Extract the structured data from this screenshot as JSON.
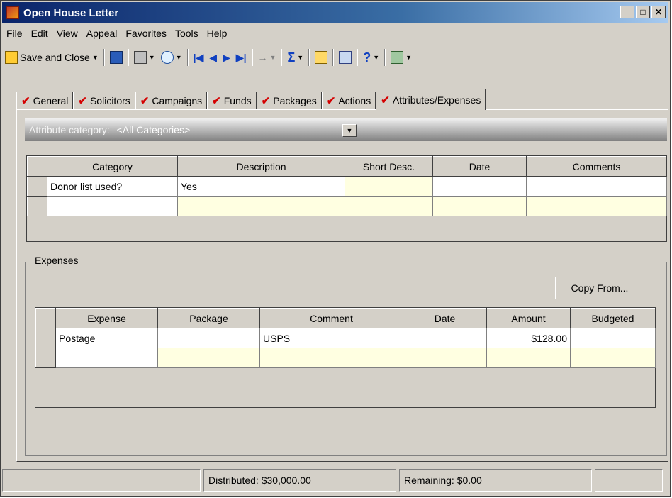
{
  "window": {
    "title": "Open House Letter"
  },
  "menu": [
    "File",
    "Edit",
    "View",
    "Appeal",
    "Favorites",
    "Tools",
    "Help"
  ],
  "toolbar": {
    "save_close": "Save and Close"
  },
  "tabs": [
    "General",
    "Solicitors",
    "Campaigns",
    "Funds",
    "Packages",
    "Actions",
    "Attributes/Expenses"
  ],
  "attributes": {
    "category_label": "Attribute category:",
    "category_value": "<All Categories>",
    "headers": [
      "Category",
      "Description",
      "Short Desc.",
      "Date",
      "Comments"
    ],
    "rows": [
      [
        "Donor list used?",
        "Yes",
        "",
        "",
        ""
      ]
    ]
  },
  "expenses": {
    "group_label": "Expenses",
    "copy_from": "Copy From...",
    "headers": [
      "Expense",
      "Package",
      "Comment",
      "Date",
      "Amount",
      "Budgeted"
    ],
    "rows": [
      [
        "Postage",
        "",
        "USPS",
        "",
        "$128.00",
        ""
      ]
    ]
  },
  "status": {
    "distributed": "Distributed: $30,000.00",
    "remaining": "Remaining: $0.00"
  }
}
